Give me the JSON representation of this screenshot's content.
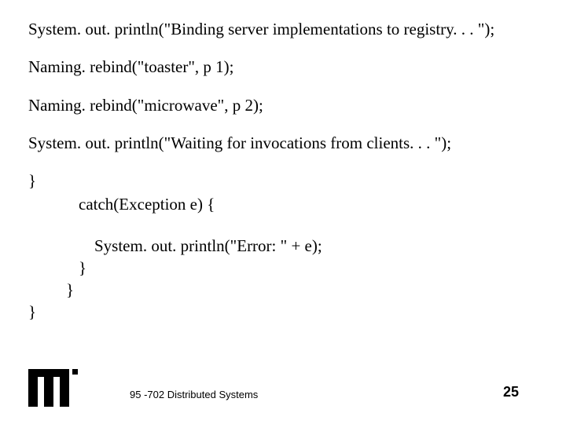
{
  "code": {
    "l1": "System. out. println(\"Binding server implementations to registry. . . \");",
    "l2": "Naming. rebind(\"toaster\", p 1);",
    "l3": "Naming. rebind(\"microwave\", p 2);",
    "l4": "System. out. println(\"Waiting for invocations from clients. . . \");",
    "l5": "}",
    "l6": "catch(Exception e) {",
    "l7": "System. out. println(\"Error: \" + e);",
    "l8": "}",
    "l9": "}",
    "l10": "}"
  },
  "footer": {
    "course": "95 -702 Distributed Systems",
    "page": "25"
  }
}
